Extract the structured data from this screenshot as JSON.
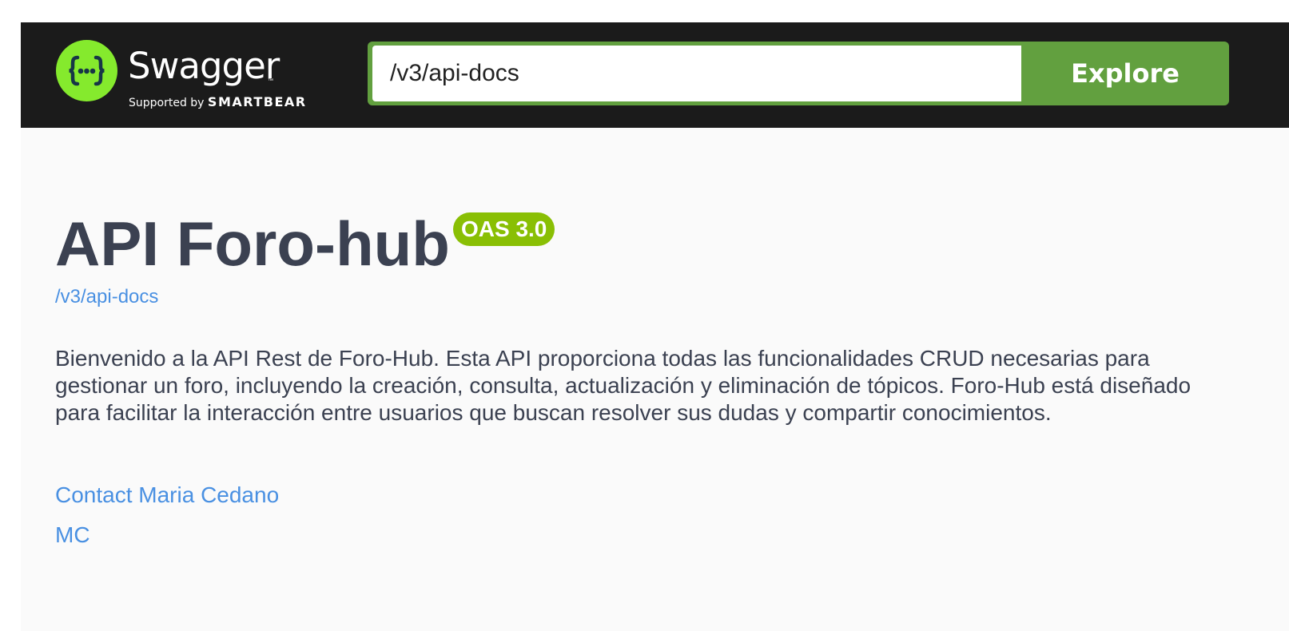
{
  "topbar": {
    "logo": {
      "word": "Swagger",
      "tm": "™",
      "supported_by": "Supported by",
      "brand": "SMARTBEAR"
    },
    "url_input_value": "/v3/api-docs",
    "explore_label": "Explore"
  },
  "info": {
    "title": "API Foro-hub",
    "version_badge": "OAS 3.0",
    "spec_url": "/v3/api-docs",
    "description": "Bienvenido a la API Rest de Foro-Hub. Esta API proporciona todas las funcionalidades CRUD necesarias para gestionar un foro, incluyendo la creación, consulta, actualización y eliminación de tópicos. Foro-Hub está diseñado para facilitar la interacción entre usuarios que buscan resolver sus dudas y compartir conocimientos.",
    "contact_label": "Contact Maria Cedano",
    "license_label": "MC"
  },
  "colors": {
    "topbar_bg": "#1b1b1b",
    "accent_green": "#62a03f",
    "logo_green": "#85ea2d",
    "badge_green": "#89bf04",
    "link_blue": "#4990e2",
    "text_dark": "#3b4151"
  }
}
